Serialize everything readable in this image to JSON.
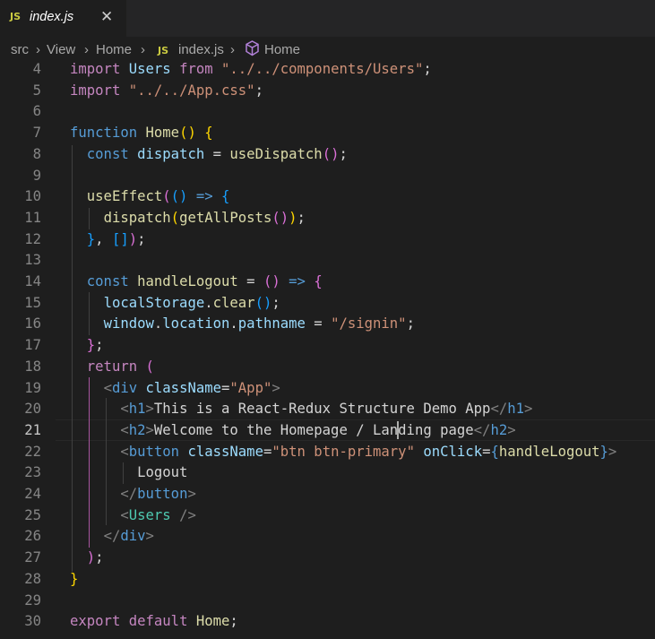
{
  "tab": {
    "icon": "JS",
    "name": "index.js",
    "close": "✕"
  },
  "breadcrumb": [
    "src",
    "View",
    "Home",
    "index.js",
    "Home"
  ],
  "breadcrumb_sep": "›",
  "breadcrumb_js": "JS",
  "lines": [
    {
      "n": "4",
      "html": "<span class='c'>import</span> <span class='v'>Users</span> <span class='c'>from</span> <span class='s'>\"../../components/Users\"</span>;"
    },
    {
      "n": "5",
      "html": "<span class='c'>import</span> <span class='s'>\"../../App.css\"</span>;"
    },
    {
      "n": "6",
      "html": ""
    },
    {
      "n": "7",
      "html": "<span class='k'>function</span> <span class='f'>Home</span><span class='y'>()</span> <span class='y'>{</span>"
    },
    {
      "n": "8",
      "html": "  <span class='k'>const</span> <span class='v'>dispatch</span> = <span class='f'>useDispatch</span><span class='p'>()</span>;"
    },
    {
      "n": "9",
      "html": ""
    },
    {
      "n": "10",
      "html": "  <span class='f'>useEffect</span><span class='p'>(</span><span class='b'>()</span> <span class='k'>=&gt;</span> <span class='b'>{</span>"
    },
    {
      "n": "11",
      "html": "    <span class='f'>dispatch</span><span class='y'>(</span><span class='f'>getAllPosts</span><span class='p'>()</span><span class='y'>)</span>;"
    },
    {
      "n": "12",
      "html": "  <span class='b'>}</span>, <span class='b'>[]</span><span class='p'>)</span>;"
    },
    {
      "n": "13",
      "html": ""
    },
    {
      "n": "14",
      "html": "  <span class='k'>const</span> <span class='f'>handleLogout</span> = <span class='p'>()</span> <span class='k'>=&gt;</span> <span class='p'>{</span>"
    },
    {
      "n": "15",
      "html": "    <span class='v'>localStorage</span>.<span class='f'>clear</span><span class='b'>()</span>;"
    },
    {
      "n": "16",
      "html": "    <span class='v'>window</span>.<span class='v'>location</span>.<span class='v'>pathname</span> = <span class='s'>\"/signin\"</span>;"
    },
    {
      "n": "17",
      "html": "  <span class='p'>}</span>;"
    },
    {
      "n": "18",
      "html": "  <span class='c'>return</span> <span class='p'>(</span>"
    },
    {
      "n": "19",
      "html": "    <span class='g'>&lt;</span><span class='k'>div</span> <span class='v'>className</span>=<span class='s'>\"App\"</span><span class='g'>&gt;</span>"
    },
    {
      "n": "20",
      "html": "      <span class='g'>&lt;</span><span class='k'>h1</span><span class='g'>&gt;</span>This is a React-Redux Structure Demo App<span class='g'>&lt;/</span><span class='k'>h1</span><span class='g'>&gt;</span>"
    },
    {
      "n": "21",
      "html": "      <span class='g'>&lt;</span><span class='k'>h2</span><span class='g'>&gt;</span>Welcome to the Homepage / Landing page<span class='g'>&lt;/</span><span class='k'>h2</span><span class='g'>&gt;</span>"
    },
    {
      "n": "22",
      "html": "      <span class='g'>&lt;</span><span class='k'>button</span> <span class='v'>className</span>=<span class='s'>\"btn btn-primary\"</span> <span class='v'>onClick</span>=<span class='k'>{</span><span class='f'>handleLogout</span><span class='k'>}</span><span class='g'>&gt;</span>"
    },
    {
      "n": "23",
      "html": "        Logout"
    },
    {
      "n": "24",
      "html": "      <span class='g'>&lt;/</span><span class='k'>button</span><span class='g'>&gt;</span>"
    },
    {
      "n": "25",
      "html": "      <span class='g'>&lt;</span><span class='t'>Users</span> <span class='g'>/&gt;</span>"
    },
    {
      "n": "26",
      "html": "    <span class='g'>&lt;/</span><span class='k'>div</span><span class='g'>&gt;</span>"
    },
    {
      "n": "27",
      "html": "  <span class='p'>)</span>;"
    },
    {
      "n": "28",
      "html": "<span class='y'>}</span>"
    },
    {
      "n": "29",
      "html": ""
    },
    {
      "n": "30",
      "html": "<span class='c'>export</span> <span class='c'>default</span> <span class='f'>Home</span>;"
    }
  ],
  "current_line": "21"
}
